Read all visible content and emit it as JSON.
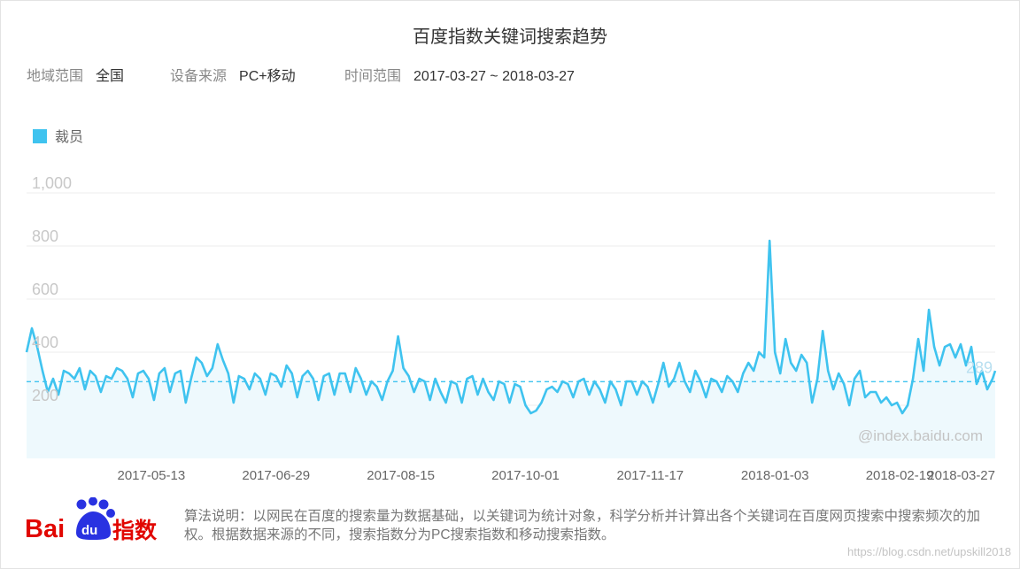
{
  "title": "百度指数关键词搜索趋势",
  "filters": {
    "region_label": "地域范围",
    "region_value": "全国",
    "device_label": "设备来源",
    "device_value": "PC+移动",
    "time_label": "时间范围",
    "time_value": "2017-03-27 ~ 2018-03-27"
  },
  "watermark": "@index.baidu.com",
  "footer_text": "算法说明：以网民在百度的搜索量为数据基础，以关键词为统计对象，科学分析并计算出各个关键词在百度网页搜索中搜索频次的加权。根据数据来源的不同，搜索指数分为PC搜索指数和移动搜索指数。",
  "logo": {
    "text_bai": "Bai",
    "text_du": "du",
    "text_zhishu": "指数"
  },
  "credit": "https://blog.csdn.net/upskill2018",
  "colors": {
    "series": "#3fc3ef",
    "fill": "#eef9fd",
    "grid": "#ececec",
    "axis_text": "#c8c8c8",
    "tick_text": "#666666",
    "logo_red": "#e10601",
    "logo_blue": "#2932e1"
  },
  "chart_data": {
    "type": "line",
    "title": "",
    "xlabel": "",
    "ylabel": "",
    "ylim": [
      0,
      1000
    ],
    "yticks": [
      200,
      400,
      600,
      800,
      1000
    ],
    "ytick_labels": [
      "200",
      "400",
      "600",
      "800",
      "1,000"
    ],
    "xlim": [
      "2017-03-27",
      "2018-03-27"
    ],
    "xtick_labels": [
      "2017-05-13",
      "2017-06-29",
      "2017-08-15",
      "2017-10-01",
      "2017-11-17",
      "2018-01-03",
      "2018-02-19",
      "2018-03-27"
    ],
    "grid": true,
    "legend_position": "top-left",
    "average_value": 289,
    "average_label": "289",
    "series": [
      {
        "name": "裁员",
        "points": [
          [
            "2017-03-27",
            400
          ],
          [
            "2017-03-29",
            490
          ],
          [
            "2017-03-31",
            420
          ],
          [
            "2017-04-02",
            330
          ],
          [
            "2017-04-04",
            250
          ],
          [
            "2017-04-06",
            300
          ],
          [
            "2017-04-08",
            240
          ],
          [
            "2017-04-10",
            330
          ],
          [
            "2017-04-12",
            320
          ],
          [
            "2017-04-14",
            300
          ],
          [
            "2017-04-16",
            340
          ],
          [
            "2017-04-18",
            260
          ],
          [
            "2017-04-20",
            330
          ],
          [
            "2017-04-22",
            310
          ],
          [
            "2017-04-24",
            250
          ],
          [
            "2017-04-26",
            310
          ],
          [
            "2017-04-28",
            300
          ],
          [
            "2017-04-30",
            340
          ],
          [
            "2017-05-02",
            330
          ],
          [
            "2017-05-04",
            300
          ],
          [
            "2017-05-06",
            230
          ],
          [
            "2017-05-08",
            320
          ],
          [
            "2017-05-10",
            330
          ],
          [
            "2017-05-12",
            300
          ],
          [
            "2017-05-14",
            220
          ],
          [
            "2017-05-16",
            320
          ],
          [
            "2017-05-18",
            340
          ],
          [
            "2017-05-20",
            250
          ],
          [
            "2017-05-22",
            320
          ],
          [
            "2017-05-24",
            330
          ],
          [
            "2017-05-26",
            210
          ],
          [
            "2017-05-28",
            300
          ],
          [
            "2017-05-30",
            380
          ],
          [
            "2017-06-01",
            360
          ],
          [
            "2017-06-03",
            310
          ],
          [
            "2017-06-05",
            340
          ],
          [
            "2017-06-07",
            430
          ],
          [
            "2017-06-09",
            370
          ],
          [
            "2017-06-11",
            320
          ],
          [
            "2017-06-13",
            210
          ],
          [
            "2017-06-15",
            310
          ],
          [
            "2017-06-17",
            300
          ],
          [
            "2017-06-19",
            260
          ],
          [
            "2017-06-21",
            320
          ],
          [
            "2017-06-23",
            300
          ],
          [
            "2017-06-25",
            240
          ],
          [
            "2017-06-27",
            320
          ],
          [
            "2017-06-29",
            310
          ],
          [
            "2017-07-01",
            270
          ],
          [
            "2017-07-03",
            350
          ],
          [
            "2017-07-05",
            320
          ],
          [
            "2017-07-07",
            230
          ],
          [
            "2017-07-09",
            310
          ],
          [
            "2017-07-11",
            330
          ],
          [
            "2017-07-13",
            300
          ],
          [
            "2017-07-15",
            220
          ],
          [
            "2017-07-17",
            310
          ],
          [
            "2017-07-19",
            320
          ],
          [
            "2017-07-21",
            240
          ],
          [
            "2017-07-23",
            320
          ],
          [
            "2017-07-25",
            320
          ],
          [
            "2017-07-27",
            250
          ],
          [
            "2017-07-29",
            340
          ],
          [
            "2017-07-31",
            300
          ],
          [
            "2017-08-02",
            240
          ],
          [
            "2017-08-04",
            290
          ],
          [
            "2017-08-06",
            270
          ],
          [
            "2017-08-08",
            220
          ],
          [
            "2017-08-10",
            290
          ],
          [
            "2017-08-12",
            330
          ],
          [
            "2017-08-14",
            460
          ],
          [
            "2017-08-16",
            340
          ],
          [
            "2017-08-18",
            310
          ],
          [
            "2017-08-20",
            250
          ],
          [
            "2017-08-22",
            300
          ],
          [
            "2017-08-24",
            290
          ],
          [
            "2017-08-26",
            220
          ],
          [
            "2017-08-28",
            300
          ],
          [
            "2017-08-30",
            250
          ],
          [
            "2017-09-01",
            210
          ],
          [
            "2017-09-03",
            290
          ],
          [
            "2017-09-05",
            280
          ],
          [
            "2017-09-07",
            210
          ],
          [
            "2017-09-09",
            300
          ],
          [
            "2017-09-11",
            310
          ],
          [
            "2017-09-13",
            240
          ],
          [
            "2017-09-15",
            300
          ],
          [
            "2017-09-17",
            250
          ],
          [
            "2017-09-19",
            220
          ],
          [
            "2017-09-21",
            290
          ],
          [
            "2017-09-23",
            280
          ],
          [
            "2017-09-25",
            210
          ],
          [
            "2017-09-27",
            280
          ],
          [
            "2017-09-29",
            270
          ],
          [
            "2017-10-01",
            200
          ],
          [
            "2017-10-03",
            170
          ],
          [
            "2017-10-05",
            180
          ],
          [
            "2017-10-07",
            210
          ],
          [
            "2017-10-09",
            260
          ],
          [
            "2017-10-11",
            270
          ],
          [
            "2017-10-13",
            250
          ],
          [
            "2017-10-15",
            290
          ],
          [
            "2017-10-17",
            280
          ],
          [
            "2017-10-19",
            230
          ],
          [
            "2017-10-21",
            290
          ],
          [
            "2017-10-23",
            300
          ],
          [
            "2017-10-25",
            240
          ],
          [
            "2017-10-27",
            290
          ],
          [
            "2017-10-29",
            260
          ],
          [
            "2017-10-31",
            210
          ],
          [
            "2017-11-02",
            290
          ],
          [
            "2017-11-04",
            260
          ],
          [
            "2017-11-06",
            200
          ],
          [
            "2017-11-08",
            290
          ],
          [
            "2017-11-10",
            290
          ],
          [
            "2017-11-12",
            240
          ],
          [
            "2017-11-14",
            290
          ],
          [
            "2017-11-16",
            270
          ],
          [
            "2017-11-18",
            210
          ],
          [
            "2017-11-20",
            280
          ],
          [
            "2017-11-22",
            360
          ],
          [
            "2017-11-24",
            270
          ],
          [
            "2017-11-26",
            300
          ],
          [
            "2017-11-28",
            360
          ],
          [
            "2017-11-30",
            290
          ],
          [
            "2017-12-02",
            250
          ],
          [
            "2017-12-04",
            330
          ],
          [
            "2017-12-06",
            290
          ],
          [
            "2017-12-08",
            230
          ],
          [
            "2017-12-10",
            300
          ],
          [
            "2017-12-12",
            290
          ],
          [
            "2017-12-14",
            250
          ],
          [
            "2017-12-16",
            310
          ],
          [
            "2017-12-18",
            290
          ],
          [
            "2017-12-20",
            250
          ],
          [
            "2017-12-22",
            320
          ],
          [
            "2017-12-24",
            360
          ],
          [
            "2017-12-26",
            330
          ],
          [
            "2017-12-28",
            400
          ],
          [
            "2017-12-30",
            380
          ],
          [
            "2018-01-01",
            820
          ],
          [
            "2018-01-03",
            400
          ],
          [
            "2018-01-05",
            320
          ],
          [
            "2018-01-07",
            450
          ],
          [
            "2018-01-09",
            360
          ],
          [
            "2018-01-11",
            330
          ],
          [
            "2018-01-13",
            390
          ],
          [
            "2018-01-15",
            360
          ],
          [
            "2018-01-17",
            210
          ],
          [
            "2018-01-19",
            300
          ],
          [
            "2018-01-21",
            480
          ],
          [
            "2018-01-23",
            330
          ],
          [
            "2018-01-25",
            260
          ],
          [
            "2018-01-27",
            320
          ],
          [
            "2018-01-29",
            280
          ],
          [
            "2018-01-31",
            200
          ],
          [
            "2018-02-02",
            300
          ],
          [
            "2018-02-04",
            330
          ],
          [
            "2018-02-06",
            230
          ],
          [
            "2018-02-08",
            250
          ],
          [
            "2018-02-10",
            250
          ],
          [
            "2018-02-12",
            210
          ],
          [
            "2018-02-14",
            230
          ],
          [
            "2018-02-16",
            200
          ],
          [
            "2018-02-18",
            210
          ],
          [
            "2018-02-20",
            170
          ],
          [
            "2018-02-22",
            200
          ],
          [
            "2018-02-24",
            300
          ],
          [
            "2018-02-26",
            450
          ],
          [
            "2018-02-28",
            330
          ],
          [
            "2018-03-02",
            560
          ],
          [
            "2018-03-04",
            420
          ],
          [
            "2018-03-06",
            350
          ],
          [
            "2018-03-08",
            420
          ],
          [
            "2018-03-10",
            430
          ],
          [
            "2018-03-12",
            380
          ],
          [
            "2018-03-14",
            430
          ],
          [
            "2018-03-16",
            350
          ],
          [
            "2018-03-18",
            420
          ],
          [
            "2018-03-20",
            280
          ],
          [
            "2018-03-22",
            330
          ],
          [
            "2018-03-24",
            260
          ],
          [
            "2018-03-26",
            300
          ],
          [
            "2018-03-27",
            330
          ]
        ]
      }
    ]
  }
}
